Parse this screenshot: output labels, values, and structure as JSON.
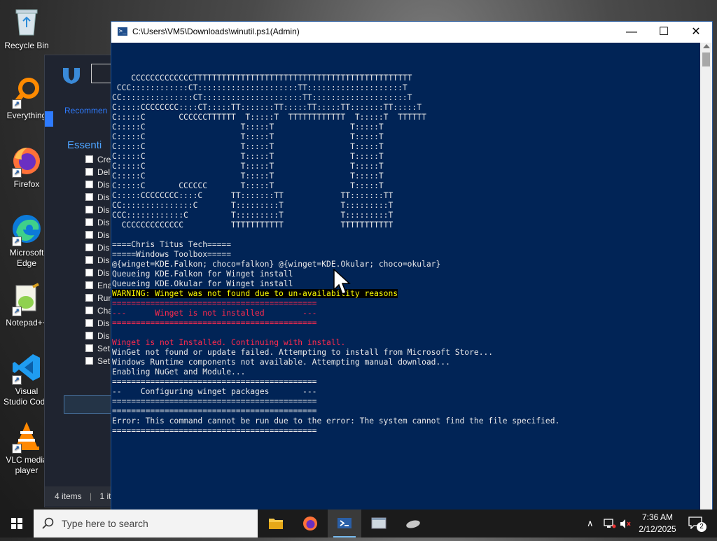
{
  "desktop": {
    "icons": [
      {
        "label": "Recycle Bin"
      },
      {
        "label": "Everything"
      },
      {
        "label": "Firefox"
      },
      {
        "label": "Microsoft Edge"
      },
      {
        "label": "Notepad++"
      },
      {
        "label": "Visual Studio Code"
      },
      {
        "label": "VLC media player"
      }
    ]
  },
  "bg_window": {
    "tab_label": "Recommen",
    "section_label": "Essenti",
    "checkbox_items": [
      "Cre",
      "Del",
      "Dis",
      "Dis",
      "Dis",
      "Dis",
      "Dis",
      "Dis",
      "Dis",
      "Dis",
      "Ena",
      "Run",
      "Cha",
      "Dis",
      "Dis",
      "Set",
      "Set"
    ],
    "status_items": "4 items",
    "status_selected": "1 ite"
  },
  "ps_window": {
    "title": "C:\\Users\\VM5\\Downloads\\winutil.ps1(Admin)",
    "lines": [
      "    CCCCCCCCCCCCCTTTTTTTTTTTTTTTTTTTTTTTTTTTTTTTTTTTTTTTTTTTTTT",
      " CCC::::::::::::CT:::::::::::::::::::::TT::::::::::::::::::::T",
      "CC:::::::::::::::CT:::::::::::::::::::::TT::::::::::::::::::::T",
      "C:::::CCCCCCCC::::CT:::::TT:::::::TT:::::TT:::::TT:::::::TT:::::T",
      "C:::::C       CCCCCCTTTTTT  T:::::T  TTTTTTTTTTTT  T:::::T  TTTTTT",
      "C:::::C                    T:::::T                T:::::T",
      "C:::::C                    T:::::T                T:::::T",
      "C:::::C                    T:::::T                T:::::T",
      "C:::::C                    T:::::T                T:::::T",
      "C:::::C                    T:::::T                T:::::T",
      "C:::::C                    T:::::T                T:::::T",
      "C:::::C       CCCCCC       T:::::T                T:::::T",
      "C:::::CCCCCCCC::::C      TT:::::::TT            TT:::::::TT",
      "CC:::::::::::::::C       T:::::::::T            T:::::::::T",
      "CCC::::::::::::C         T:::::::::T            T:::::::::T",
      "  CCCCCCCCCCCCC          TTTTTTTTTTT            TTTTTTTTTTT",
      "",
      "====Chris Titus Tech=====",
      "=====Windows Toolbox=====",
      "@{winget=KDE.Falkon; choco=falkon} @{winget=KDE.Okular; choco=okular}",
      "Queueing KDE.Falkon for Winget install",
      "Queueing KDE.Okular for Winget install",
      "WARNING: Winget was not found due to un-availability reasons",
      "===========================================",
      "---      Winget is not installed        ---",
      "===========================================",
      "",
      "Winget is not Installed. Continuing with install.",
      "WinGet not found or update failed. Attempting to install from Microsoft Store...",
      "Windows Runtime components not available. Attempting manual download...",
      "Enabling NuGet and Module...",
      "===========================================",
      "--    Configuring winget packages       ---",
      "===========================================",
      "===========================================",
      "Error: This command cannot be run due to the error: The system cannot find the file specified.",
      "==========================================="
    ]
  },
  "taskbar": {
    "search_placeholder": "Type here to search",
    "time": "7:36 AM",
    "date": "2/12/2025",
    "notification_count": "2"
  },
  "colors": {
    "ps_background": "#012456",
    "ps_text": "#e8e8e8",
    "warning_text": "#ffff00",
    "error_text": "#ff2a4d",
    "accent": "#2e7bff"
  }
}
